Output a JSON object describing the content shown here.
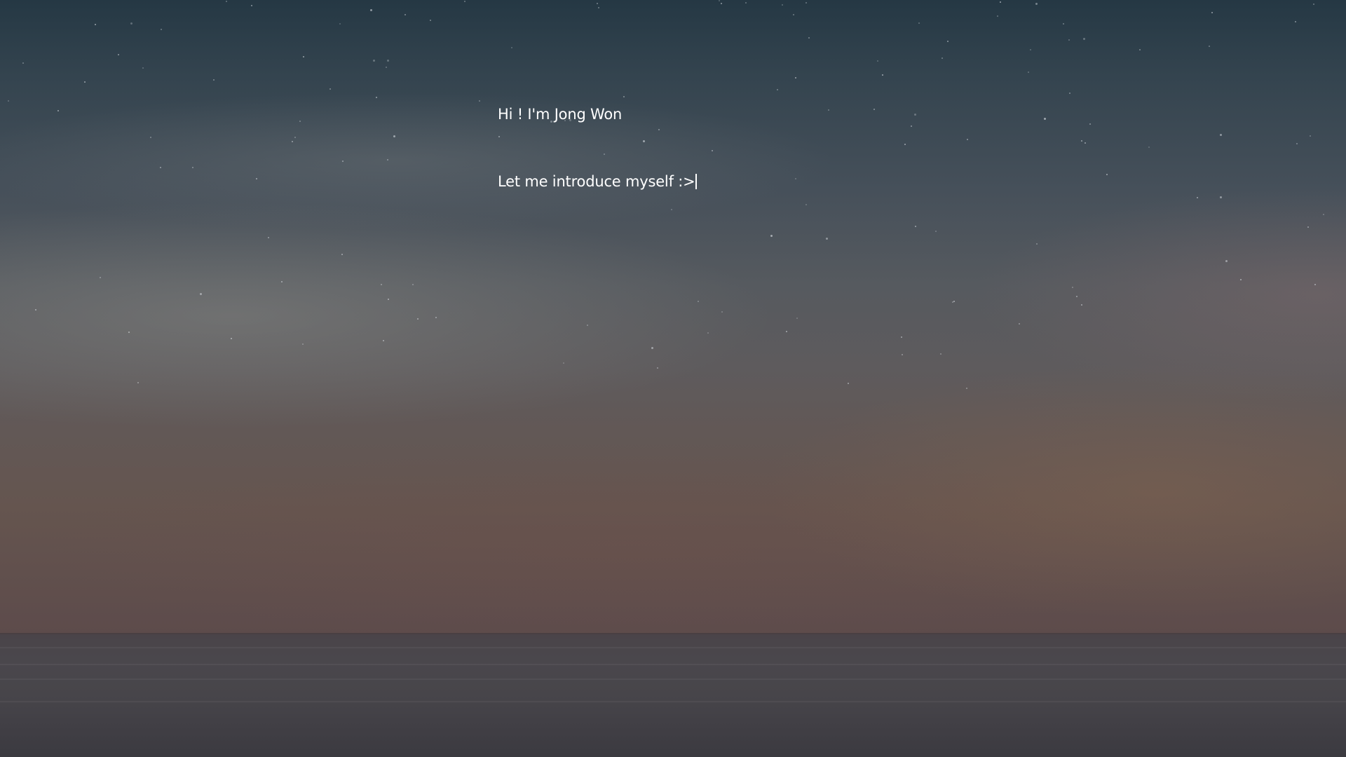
{
  "hero": {
    "greeting": "Hi ! I'm Jong Won",
    "subline": "Let me introduce myself :>"
  },
  "colors": {
    "text": "#ffffff",
    "sky_top": "#253844",
    "sky_bottom": "#5d4b4b",
    "sea": "#413f45"
  }
}
